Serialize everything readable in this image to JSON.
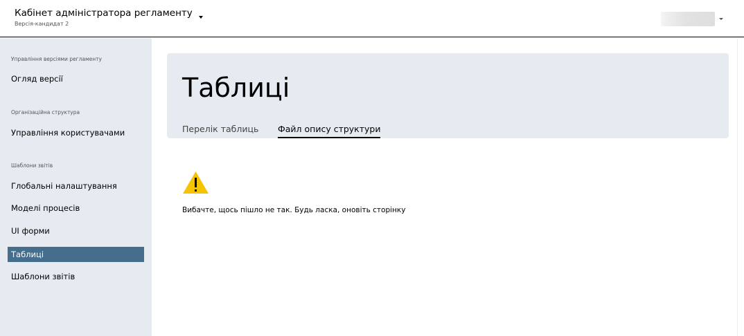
{
  "header": {
    "title": "Кабінет адміністратора регламенту",
    "subtitle": "Версія-кандидат 2",
    "user_menu_icon": "caret-down-icon"
  },
  "sidebar": {
    "sections": [
      {
        "label": "Управління версіями регламенту",
        "items": [
          {
            "label": "Огляд версії"
          }
        ]
      },
      {
        "label": "Організаційна структура",
        "items": [
          {
            "label": "Управління користувачами"
          }
        ]
      },
      {
        "label": "Шаблони звітів",
        "items": [
          {
            "label": "Глобальні налаштування"
          },
          {
            "label": "Моделі процесів"
          },
          {
            "label": "UI форми"
          },
          {
            "label": "Таблиці",
            "active": true
          },
          {
            "label": "Шаблони звітів"
          }
        ]
      }
    ]
  },
  "main": {
    "title": "Таблиці",
    "tabs": [
      {
        "label": "Перелік таблиць",
        "active": false
      },
      {
        "label": "Файл опису структури",
        "active": true
      }
    ],
    "error": {
      "icon": "warning-icon",
      "message": "Вибачте, щось пішло не так. Будь ласка, оновіть сторінку"
    }
  },
  "colors": {
    "sidebar_bg": "#e5ebf1",
    "active_item": "#456d8c",
    "warning": "#f5c400"
  }
}
